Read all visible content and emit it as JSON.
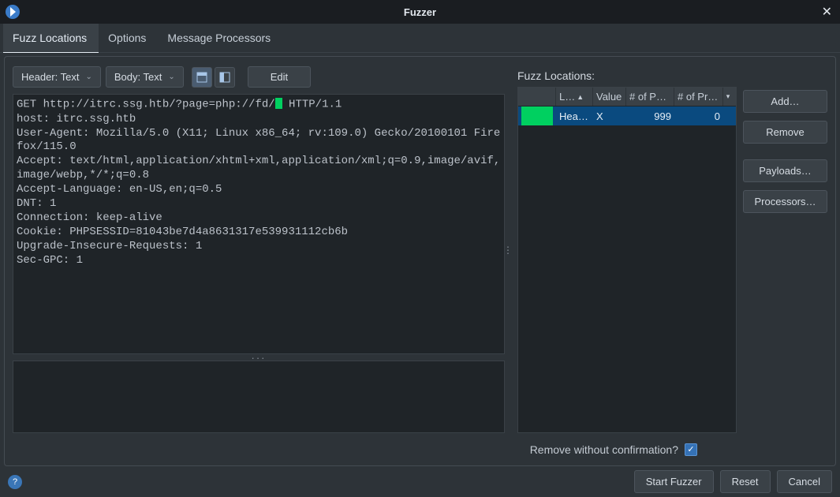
{
  "window": {
    "title": "Fuzzer"
  },
  "tabs": [
    {
      "label": "Fuzz Locations",
      "active": true
    },
    {
      "label": "Options"
    },
    {
      "label": "Message Processors"
    }
  ],
  "left": {
    "header_dropdown": "Header: Text",
    "body_dropdown": "Body: Text",
    "edit_button": "Edit",
    "request_before": "GET http://itrc.ssg.htb/?page=php://fd/",
    "request_after": " HTTP/1.1\nhost: itrc.ssg.htb\nUser-Agent: Mozilla/5.0 (X11; Linux x86_64; rv:109.0) Gecko/20100101 Firefox/115.0\nAccept: text/html,application/xhtml+xml,application/xml;q=0.9,image/avif,image/webp,*/*;q=0.8\nAccept-Language: en-US,en;q=0.5\nDNT: 1\nConnection: keep-alive\nCookie: PHPSESSID=81043be7d4a8631317e539931112cb6b\nUpgrade-Insecure-Requests: 1\nSec-GPC: 1"
  },
  "right": {
    "label": "Fuzz Locations:",
    "columns": {
      "c1": "L…",
      "c2": "Value",
      "c3": "# of P…",
      "c4": "# of Pr…"
    },
    "row": {
      "loc": "Hea…",
      "value": "X",
      "payloads": "999",
      "procs": "0"
    },
    "buttons": {
      "add": "Add…",
      "remove": "Remove",
      "payloads": "Payloads…",
      "processors": "Processors…"
    },
    "remove_without_confirmation": "Remove without confirmation?"
  },
  "footer": {
    "start": "Start Fuzzer",
    "reset": "Reset",
    "cancel": "Cancel"
  }
}
